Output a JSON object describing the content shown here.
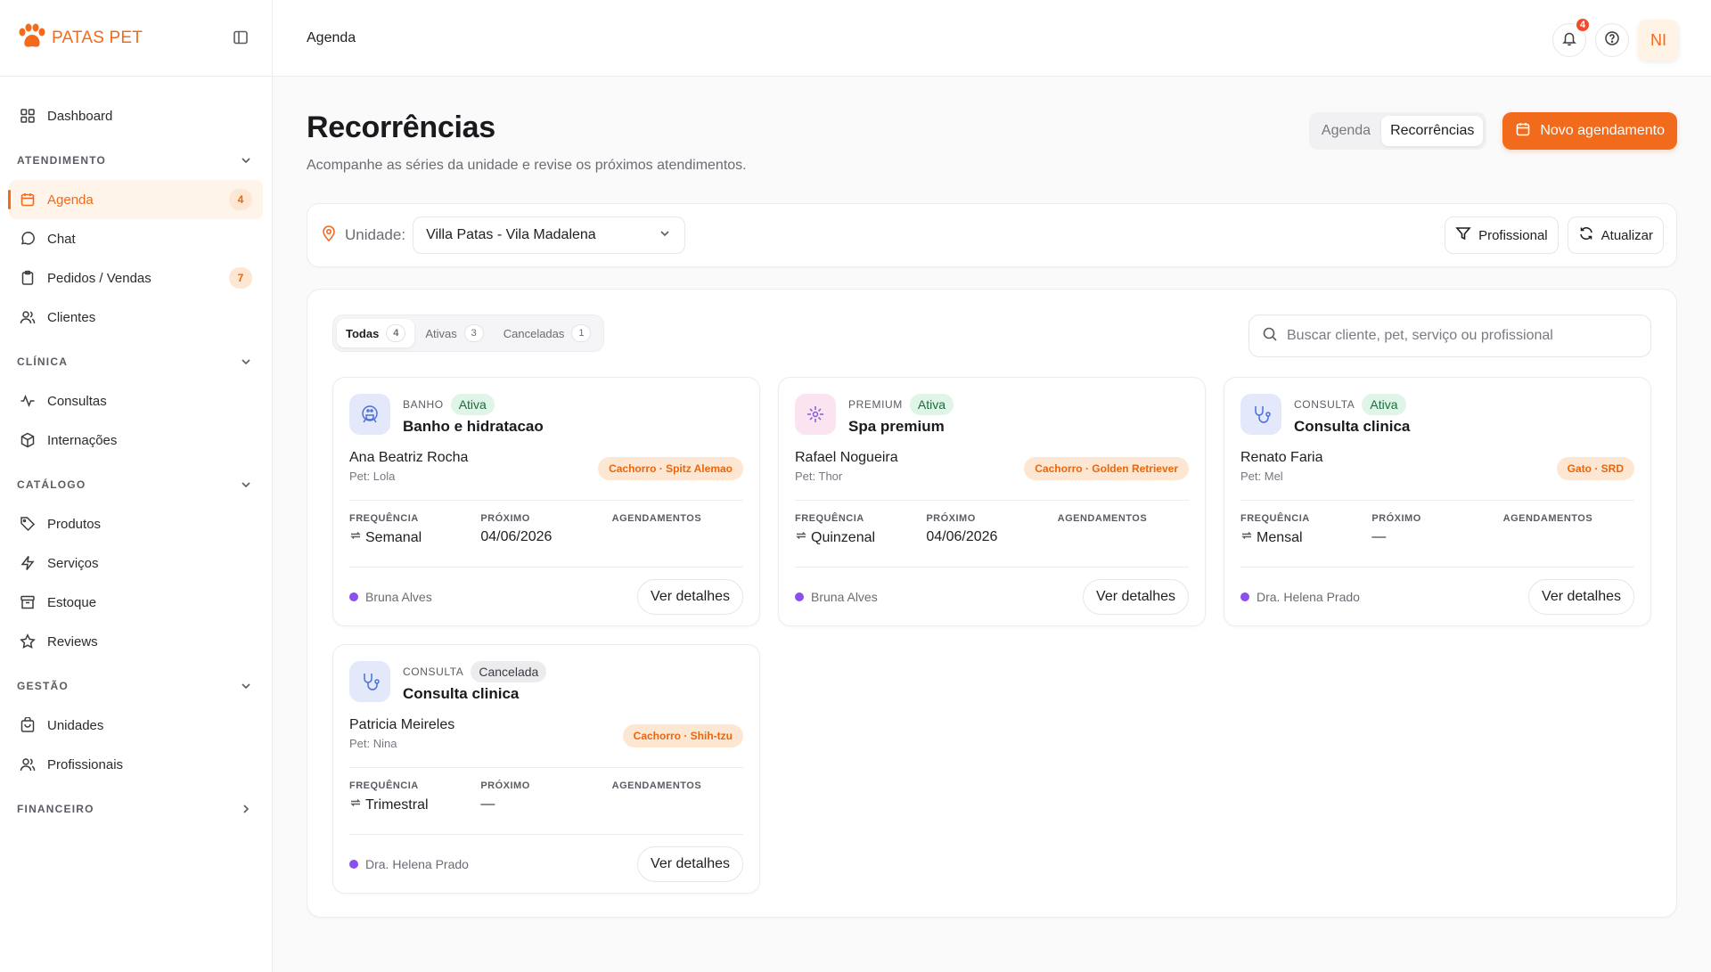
{
  "brand": {
    "name": "PATAS PET"
  },
  "colors": {
    "accent": "#f26a1b",
    "badge_bg": "#fde7d3",
    "active_green": "#def5e7",
    "pro_dot": "#8b4ef0"
  },
  "sidebar": {
    "top_items": [
      {
        "label": "Dashboard",
        "icon": "dashboard-icon"
      }
    ],
    "sections": [
      {
        "title": "ATENDIMENTO",
        "expanded": true,
        "items": [
          {
            "label": "Agenda",
            "icon": "calendar-icon",
            "badge": "4",
            "active": true
          },
          {
            "label": "Chat",
            "icon": "chat-icon"
          },
          {
            "label": "Pedidos / Vendas",
            "icon": "clipboard-icon",
            "badge": "7"
          },
          {
            "label": "Clientes",
            "icon": "users-icon"
          }
        ]
      },
      {
        "title": "CLÍNICA",
        "expanded": true,
        "items": [
          {
            "label": "Consultas",
            "icon": "activity-icon"
          },
          {
            "label": "Internações",
            "icon": "box-icon"
          }
        ]
      },
      {
        "title": "CATÁLOGO",
        "expanded": true,
        "items": [
          {
            "label": "Produtos",
            "icon": "tag-icon"
          },
          {
            "label": "Serviços",
            "icon": "zap-icon"
          },
          {
            "label": "Estoque",
            "icon": "archive-icon"
          },
          {
            "label": "Reviews",
            "icon": "star-icon"
          }
        ]
      },
      {
        "title": "GESTÃO",
        "expanded": true,
        "items": [
          {
            "label": "Unidades",
            "icon": "store-icon"
          },
          {
            "label": "Profissionais",
            "icon": "users-icon"
          }
        ]
      },
      {
        "title": "FINANCEIRO",
        "expanded": false,
        "items": []
      }
    ]
  },
  "topbar": {
    "title": "Agenda",
    "notifications": "4",
    "avatar_initials": "NI"
  },
  "page": {
    "title": "Recorrências",
    "subtitle": "Acompanhe as séries da unidade e revise os próximos atendimentos.",
    "view_toggle": [
      "Agenda",
      "Recorrências"
    ],
    "view_selected": "Recorrências",
    "new_button": "Novo agendamento"
  },
  "filters": {
    "unit_label": "Unidade:",
    "unit_value": "Villa Patas - Vila Madalena",
    "professional_button": "Profissional",
    "refresh_button": "Atualizar"
  },
  "tabs": [
    {
      "label": "Todas",
      "count": "4",
      "active": true
    },
    {
      "label": "Ativas",
      "count": "3"
    },
    {
      "label": "Canceladas",
      "count": "1"
    }
  ],
  "search": {
    "placeholder": "Buscar cliente, pet, serviço ou profissional"
  },
  "stat_labels": {
    "frequency": "FREQUÊNCIA",
    "next": "PRÓXIMO",
    "appointments": "AGENDAMENTOS"
  },
  "details_label": "Ver detalhes",
  "cards": [
    {
      "category": "BANHO",
      "status": "Ativa",
      "service": "Banho e hidratacao",
      "client": "Ana Beatriz Rocha",
      "pet": "Pet: Lola",
      "breed": "Cachorro · Spitz Alemao",
      "frequency": "Semanal",
      "next": "04/06/2026",
      "appointments": "",
      "professional": "Bruna Alves",
      "icon": "bath-icon",
      "icon_tone": "blue"
    },
    {
      "category": "PREMIUM",
      "status": "Ativa",
      "service": "Spa premium",
      "client": "Rafael Nogueira",
      "pet": "Pet: Thor",
      "breed": "Cachorro · Golden Retriever",
      "frequency": "Quinzenal",
      "next": "04/06/2026",
      "appointments": "",
      "professional": "Bruna Alves",
      "icon": "sparkle-icon",
      "icon_tone": "pink"
    },
    {
      "category": "CONSULTA",
      "status": "Ativa",
      "service": "Consulta clinica",
      "client": "Renato Faria",
      "pet": "Pet: Mel",
      "breed": "Gato · SRD",
      "frequency": "Mensal",
      "next": "—",
      "appointments": "",
      "professional": "Dra. Helena Prado",
      "icon": "stethoscope-icon",
      "icon_tone": "blue"
    },
    {
      "category": "CONSULTA",
      "status": "Cancelada",
      "service": "Consulta clinica",
      "client": "Patricia Meireles",
      "pet": "Pet: Nina",
      "breed": "Cachorro · Shih-tzu",
      "frequency": "Trimestral",
      "next": "—",
      "appointments": "",
      "professional": "Dra. Helena Prado",
      "icon": "stethoscope-icon",
      "icon_tone": "blue"
    }
  ]
}
